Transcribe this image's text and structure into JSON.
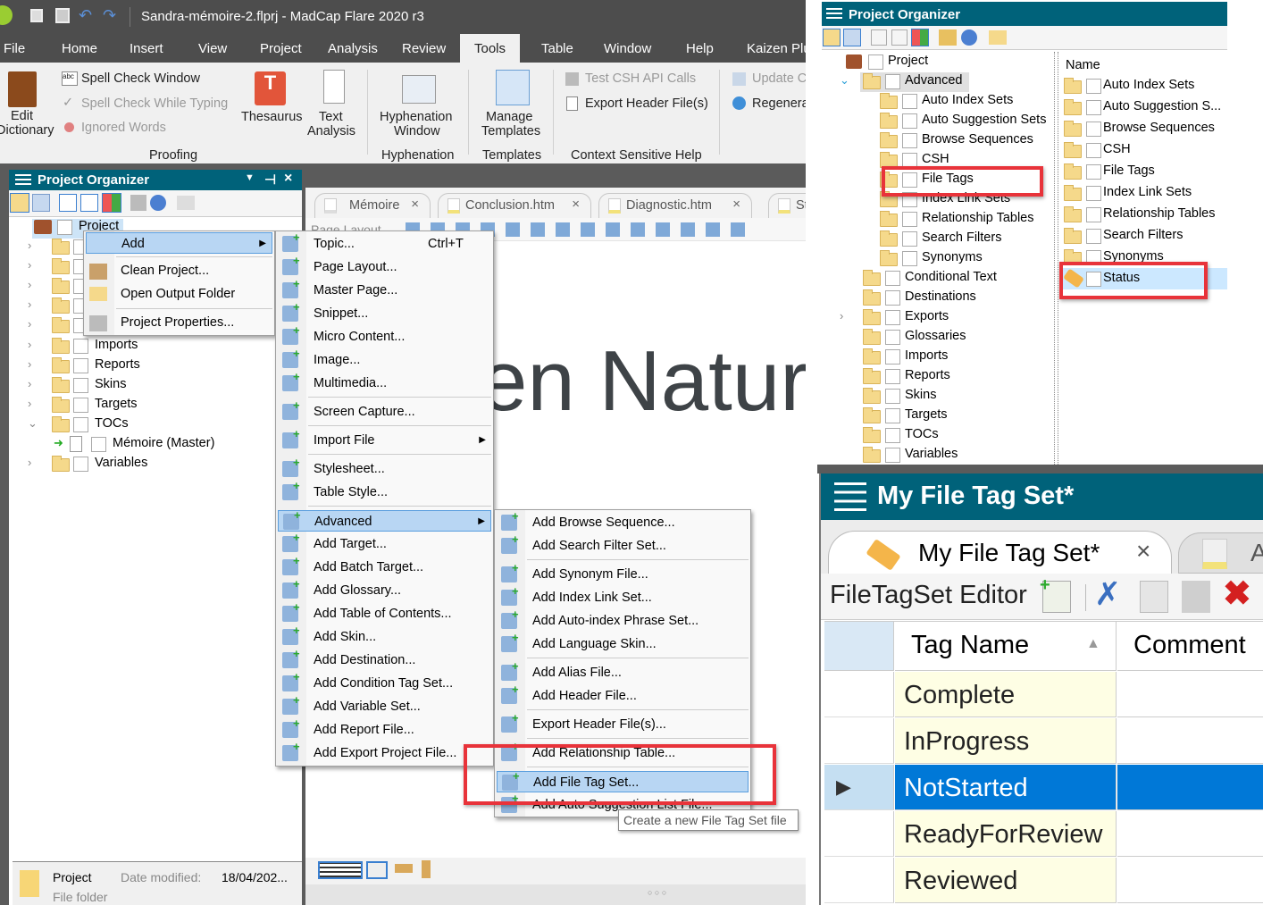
{
  "app": {
    "title": "Sandra-mémoire-2.flprj - MadCap Flare 2020 r3",
    "menu": [
      "File",
      "Home",
      "Insert",
      "View",
      "Project",
      "Analysis",
      "Review",
      "Tools",
      "Table",
      "Window",
      "Help",
      "Kaizen Plu"
    ],
    "active_menu": "Tools"
  },
  "ribbon": {
    "edit_dictionary": [
      "Edit",
      "Dictionary"
    ],
    "spell_check_window": "Spell Check Window",
    "spell_check_while_typing": "Spell Check While Typing",
    "ignored_words": "Ignored Words",
    "thesaurus": "Thesaurus",
    "text_analysis": [
      "Text",
      "Analysis"
    ],
    "hyphenation_window": [
      "Hyphenation",
      "Window"
    ],
    "manage_templates": [
      "Manage",
      "Templates"
    ],
    "test_csh": "Test CSH API Calls",
    "export_header": "Export Header File(s)",
    "update": "Update C",
    "regenerate": "Regenera",
    "groups": {
      "proofing": "Proofing",
      "hyphenation": "Hyphenation",
      "templates": "Templates",
      "csh": "Context Sensitive Help"
    }
  },
  "left_organizer": {
    "title": "Project Organizer",
    "root": "Project",
    "items": [
      "Imports",
      "Reports",
      "Skins",
      "Targets",
      "TOCs"
    ],
    "toc_child": "Mémoire (Master)",
    "last": "Variables",
    "footer": {
      "name": "Project",
      "type": "File folder",
      "date_label": "Date modified:",
      "date": "18/04/202..."
    }
  },
  "editor": {
    "tabs": [
      "Mémoire",
      "Conclusion.htm",
      "Diagnostic.htm",
      "St"
    ],
    "toolbar_label": "Page Layout",
    "content_text": "en Naturo",
    "status_dots": "○ ○ ○"
  },
  "context_menu": {
    "add": "Add",
    "clean": "Clean Project...",
    "open_output": "Open Output Folder",
    "properties": "Project Properties..."
  },
  "add_menu": {
    "items": [
      {
        "label": "Topic...",
        "shortcut": "Ctrl+T"
      },
      {
        "label": "Page Layout..."
      },
      {
        "label": "Master Page..."
      },
      {
        "label": "Snippet..."
      },
      {
        "label": "Micro Content..."
      },
      {
        "label": "Image..."
      },
      {
        "label": "Multimedia..."
      },
      {
        "label": "Screen Capture..."
      },
      {
        "label": "Import File",
        "submenu": true
      },
      {
        "label": "Stylesheet..."
      },
      {
        "label": "Table Style..."
      },
      {
        "label": "Advanced",
        "submenu": true,
        "highlighted": true
      },
      {
        "label": "Add Target..."
      },
      {
        "label": "Add Batch Target..."
      },
      {
        "label": "Add Glossary..."
      },
      {
        "label": "Add Table of Contents..."
      },
      {
        "label": "Add Skin..."
      },
      {
        "label": "Add Destination..."
      },
      {
        "label": "Add Condition Tag Set..."
      },
      {
        "label": "Add Variable Set..."
      },
      {
        "label": "Add Report File..."
      },
      {
        "label": "Add Export Project File..."
      }
    ]
  },
  "advanced_menu": {
    "items": [
      {
        "label": "Add Browse Sequence..."
      },
      {
        "label": "Add Search Filter Set..."
      },
      {
        "label": "Add Synonym File..."
      },
      {
        "label": "Add Index Link Set..."
      },
      {
        "label": "Add Auto-index Phrase Set..."
      },
      {
        "label": "Add Language Skin..."
      },
      {
        "label": "Add Alias File..."
      },
      {
        "label": "Add Header File..."
      },
      {
        "label": "Export Header File(s)..."
      },
      {
        "label": "Add Relationship Table..."
      },
      {
        "label": "Add File Tag Set...",
        "highlighted": true
      },
      {
        "label": "Add Auto Suggestion List File..."
      }
    ],
    "tooltip": "Create a new File Tag Set file"
  },
  "right_organizer": {
    "title": "Project Organizer",
    "root": "Project",
    "advanced": "Advanced",
    "advanced_children": [
      "Auto Index Sets",
      "Auto Suggestion Sets",
      "Browse Sequences",
      "CSH",
      "File Tags",
      "Index Link Sets",
      "Relationship Tables",
      "Search Filters",
      "Synonyms"
    ],
    "top_items": [
      "Conditional Text",
      "Destinations",
      "Exports",
      "Glossaries",
      "Imports",
      "Reports",
      "Skins",
      "Targets",
      "TOCs",
      "Variables"
    ],
    "list_header": "Name",
    "list_items": [
      "Auto Index Sets",
      "Auto Suggestion S...",
      "Browse Sequences",
      "CSH",
      "File Tags",
      "Index Link Sets",
      "Relationship Tables",
      "Search Filters",
      "Synonyms"
    ],
    "selected_item": "Status"
  },
  "file_tag_set": {
    "title": "My File Tag Set*",
    "tab": "My File Tag Set*",
    "tab2": "A",
    "editor_label": "FileTagSet Editor",
    "columns": [
      "Tag Name",
      "Comment"
    ],
    "rows": [
      "Complete",
      "InProgress",
      "NotStarted",
      "ReadyForReview",
      "Reviewed"
    ],
    "selected_row": "NotStarted"
  },
  "colors": {
    "panel_title": "#00627a",
    "selection": "#0078d7",
    "highlight": "#b8d6f3",
    "annotation": "#e8333a",
    "tag_cell": "#fefee4"
  }
}
